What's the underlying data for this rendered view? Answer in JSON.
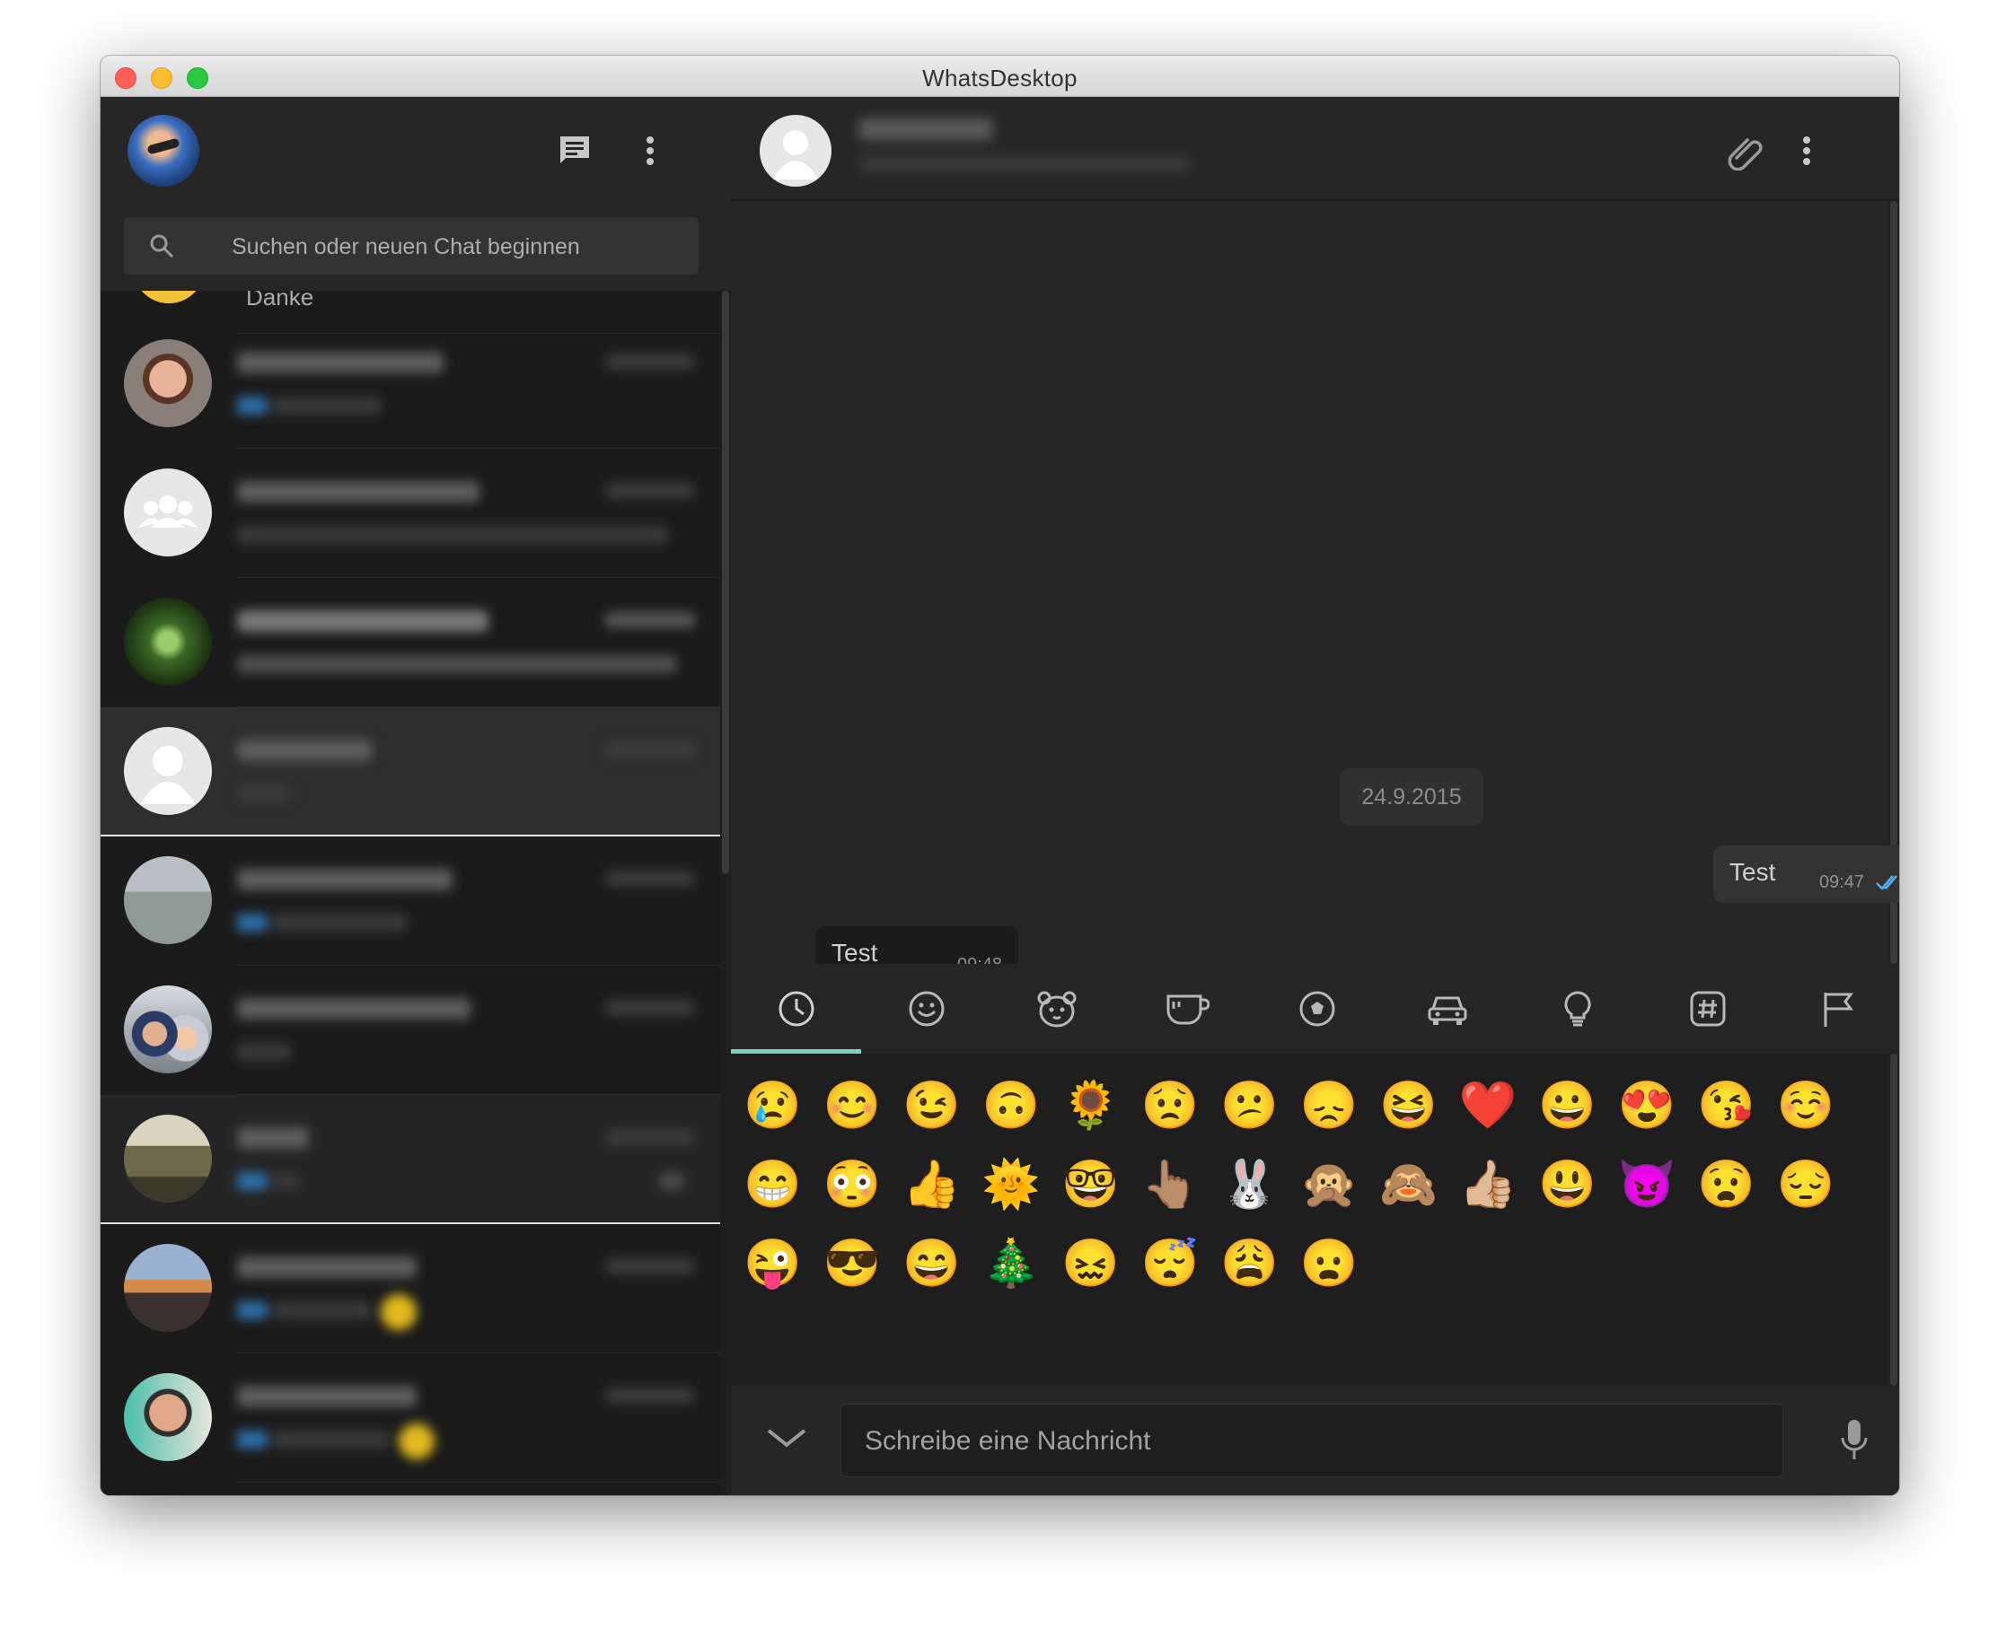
{
  "window": {
    "title": "WhatsDesktop"
  },
  "left": {
    "search": {
      "placeholder": "Suchen oder neuen Chat beginnen"
    },
    "partial_chat": {
      "preview": "Danke"
    },
    "chats": [
      {
        "id": "chat-1",
        "avatar": "photo-man-glasses"
      },
      {
        "id": "chat-2",
        "avatar": "group-icon"
      },
      {
        "id": "chat-3",
        "avatar": "photo-green-art"
      },
      {
        "id": "chat-4",
        "avatar": "default-user-icon",
        "selected": true
      },
      {
        "id": "chat-5",
        "avatar": "photo-beach"
      },
      {
        "id": "chat-6",
        "avatar": "photo-two-people"
      },
      {
        "id": "chat-7",
        "avatar": "photo-landscape"
      },
      {
        "id": "chat-8",
        "avatar": "photo-sunset"
      },
      {
        "id": "chat-9",
        "avatar": "photo-man-sunglasses"
      }
    ]
  },
  "conversation": {
    "date_chip": "24.9.2015",
    "messages": [
      {
        "direction": "out",
        "text": "Test",
        "time": "09:47",
        "status": "read"
      },
      {
        "direction": "in",
        "text": "Test",
        "time": "09:48"
      }
    ]
  },
  "emoji_panel": {
    "tabs": [
      "recent-icon",
      "smiley-icon",
      "animal-icon",
      "food-icon",
      "sports-icon",
      "travel-icon",
      "objects-icon",
      "symbols-icon",
      "flags-icon"
    ],
    "active_tab": "recent-icon",
    "emojis": [
      "😢",
      "😊",
      "😉",
      "🙃",
      "🌻",
      "😟",
      "😕",
      "😞",
      "😆",
      "❤️",
      "😀",
      "😍",
      "😘",
      "☺️",
      "😁",
      "😳",
      "👍",
      "🌞",
      "🤓",
      "👆🏽",
      "🐰",
      "🙊",
      "🙈",
      "👍🏼",
      "😃",
      "😈",
      "😧",
      "😔",
      "😜",
      "😎",
      "😄",
      "🎄",
      "😖",
      "😴",
      "😩",
      "😦"
    ]
  },
  "composer": {
    "placeholder": "Schreibe eine Nachricht"
  },
  "colors": {
    "accent": "#7fd0c8",
    "read_tick": "#4fb3f6"
  }
}
